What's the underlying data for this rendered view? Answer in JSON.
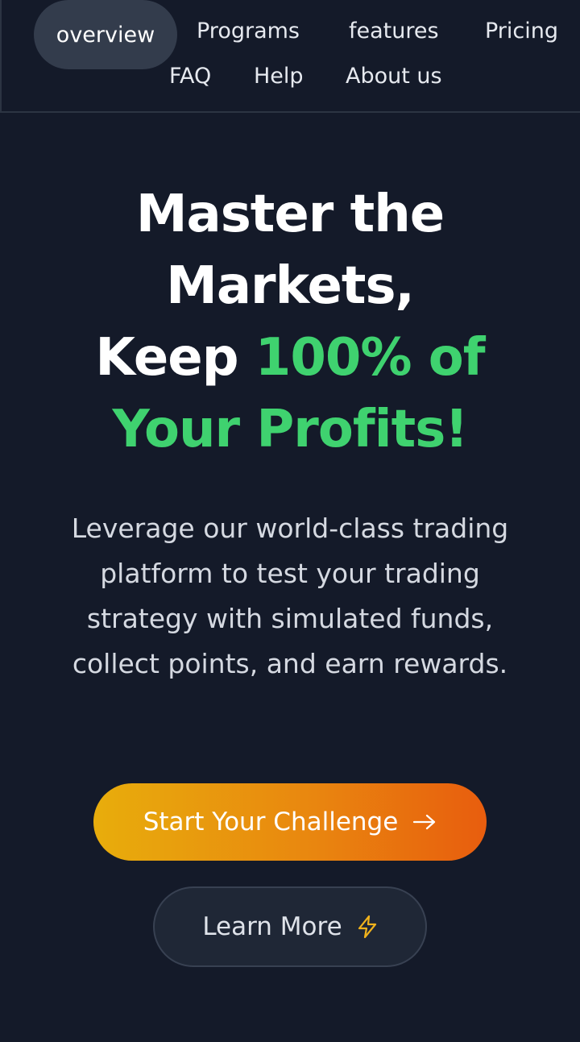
{
  "nav": {
    "items": [
      {
        "label": "overview",
        "active": true
      },
      {
        "label": "Programs"
      },
      {
        "label": "features"
      },
      {
        "label": "Pricing"
      },
      {
        "label": "FAQ"
      },
      {
        "label": "Help"
      },
      {
        "label": "About us"
      }
    ]
  },
  "hero": {
    "title_line1": "Master the",
    "title_line2": "Markets,",
    "title_line3_plain": "Keep ",
    "title_line3_accent": "100% of",
    "title_line4_accent": "Your Profits!",
    "description": "Leverage our world-class trading platform to test your trading strategy with simulated funds, collect points, and earn rewards."
  },
  "buttons": {
    "primary_label": "Start Your Challenge",
    "primary_icon": "arrow-right-icon",
    "secondary_label": "Learn More",
    "secondary_icon": "lightning-icon"
  },
  "colors": {
    "background": "#141a29",
    "accent_green": "#3fd26f",
    "gradient_start": "#e8ad0c",
    "gradient_end": "#e85d0e",
    "lightning": "#f0b21c"
  }
}
